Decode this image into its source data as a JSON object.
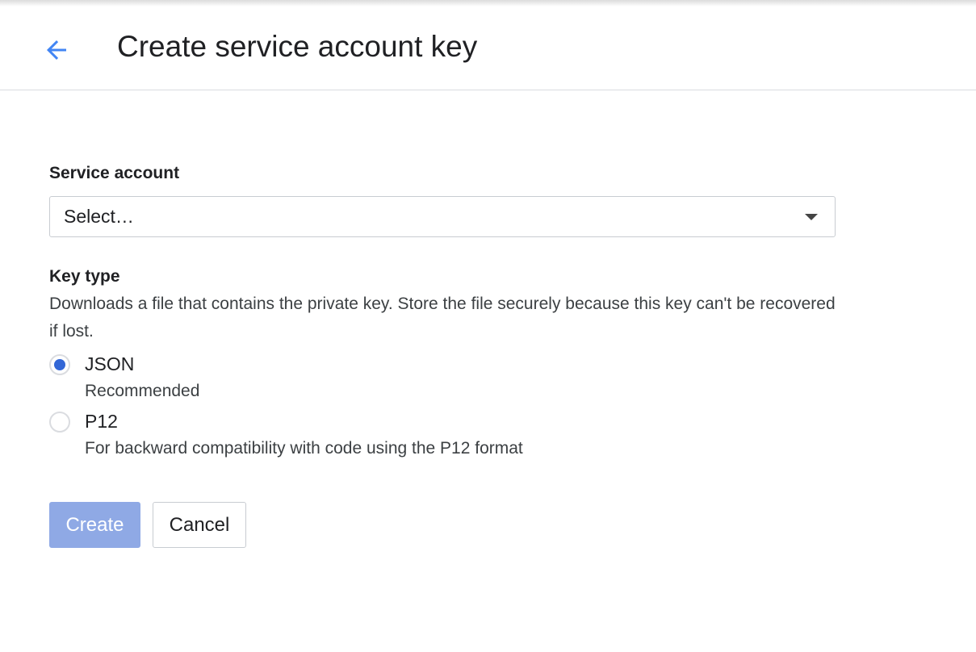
{
  "header": {
    "title": "Create service account key",
    "back_icon": "arrow-back-icon"
  },
  "service_account": {
    "label": "Service account",
    "selected_value": "Select…"
  },
  "key_type": {
    "label": "Key type",
    "description": "Downloads a file that contains the private key. Store the file securely because this key can't be recovered if lost.",
    "options": [
      {
        "label": "JSON",
        "hint": "Recommended",
        "checked": true
      },
      {
        "label": "P12",
        "hint": "For backward compatibility with code using the P12 format",
        "checked": false
      }
    ]
  },
  "actions": {
    "create_label": "Create",
    "cancel_label": "Cancel"
  },
  "colors": {
    "accent": "#4285f4",
    "radio_selected": "#3367d6",
    "create_disabled": "#8fa9e5"
  }
}
